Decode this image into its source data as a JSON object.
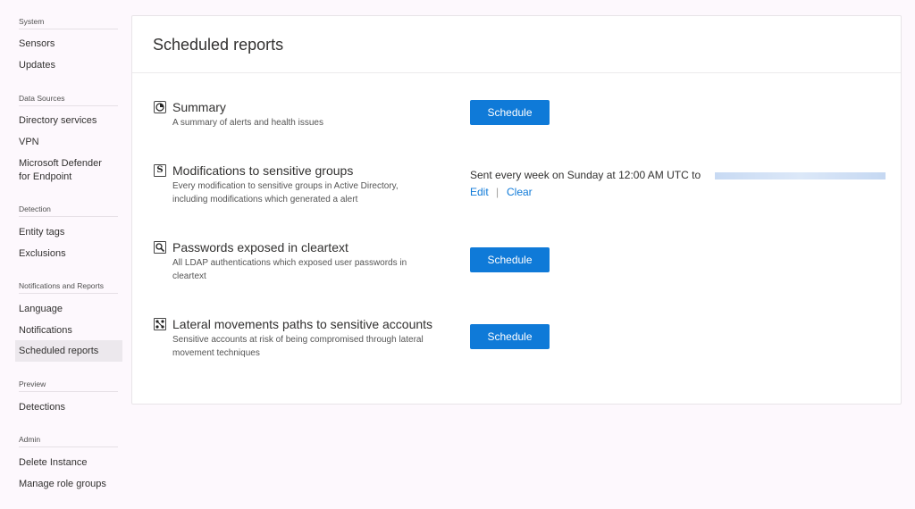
{
  "sidebar": {
    "groups": [
      {
        "header": "System",
        "items": [
          "Sensors",
          "Updates"
        ]
      },
      {
        "header": "Data Sources",
        "items": [
          "Directory services",
          "VPN",
          "Microsoft Defender",
          "for Endpoint"
        ]
      },
      {
        "header": "Detection",
        "items": [
          "Entity tags",
          "Exclusions"
        ]
      },
      {
        "header": "Notifications and Reports",
        "items": [
          "Language",
          "Notifications",
          "Scheduled reports"
        ]
      },
      {
        "header": "Preview",
        "items": [
          "Detections"
        ]
      },
      {
        "header": "Admin",
        "items": [
          "Delete Instance",
          "Manage role groups"
        ]
      }
    ],
    "active_item": "Scheduled reports"
  },
  "main": {
    "title": "Scheduled reports",
    "reports": [
      {
        "icon": "pie-chart-icon",
        "title": "Summary",
        "desc_lines": [
          "A summary of alerts and health issues"
        ],
        "schedule_label": "Schedule"
      },
      {
        "icon": "sensitive-groups-icon",
        "title": "Modifications to sensitive groups",
        "desc_lines": [
          "Every modification to sensitive groups in Active Directory,",
          "including modifications which generated a alert"
        ],
        "sent_text": "Sent every week on Sunday at 12:00 AM UTC to",
        "edit_label": "Edit",
        "separator": "|",
        "clear_label": "Clear"
      },
      {
        "icon": "magnifier-icon",
        "title": "Passwords exposed in cleartext",
        "desc_lines": [
          "All LDAP authentications which exposed user passwords in",
          "cleartext"
        ],
        "schedule_label": "Schedule"
      },
      {
        "icon": "lateral-paths-icon",
        "title": "Lateral movements paths to sensitive accounts",
        "desc_lines": [
          "Sensitive accounts at risk of being compromised through lateral",
          "movement techniques"
        ],
        "schedule_label": "Schedule"
      }
    ]
  },
  "colors": {
    "accent": "#0f7ad8",
    "background": "#fdf8fd",
    "active_nav": "#ece8ed"
  }
}
